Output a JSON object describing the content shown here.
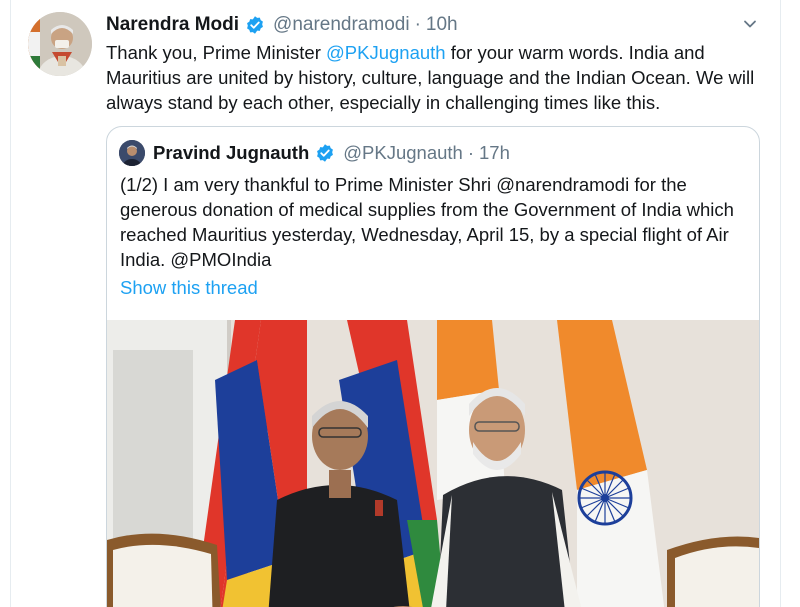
{
  "tweet": {
    "author_name": "Narendra Modi",
    "author_handle": "@narendramodi",
    "separator": "·",
    "time": "10h",
    "text_before": "Thank you, Prime Minister ",
    "mention": "@PKJugnauth",
    "text_after": " for your warm words.  India and Mauritius are united by history, culture, language and the Indian Ocean.  We will always stand by each other, especially in challenging times like this."
  },
  "quoted": {
    "author_name": "Pravind Jugnauth",
    "author_handle": "@PKJugnauth",
    "separator": "·",
    "time": "17h",
    "text": "(1/2) I am very thankful to Prime Minister Shri @narendramodi for the generous donation of medical supplies from the Government of India which reached Mauritius yesterday, Wednesday, April 15,  by a special flight of Air India. @PMOIndia",
    "show_thread": "Show this thread"
  },
  "icons": {
    "verified": "verified-badge-icon",
    "caret": "chevron-down-icon"
  },
  "colors": {
    "link": "#1da1f2",
    "secondary_text": "#657786",
    "border": "#ccd6dd"
  }
}
